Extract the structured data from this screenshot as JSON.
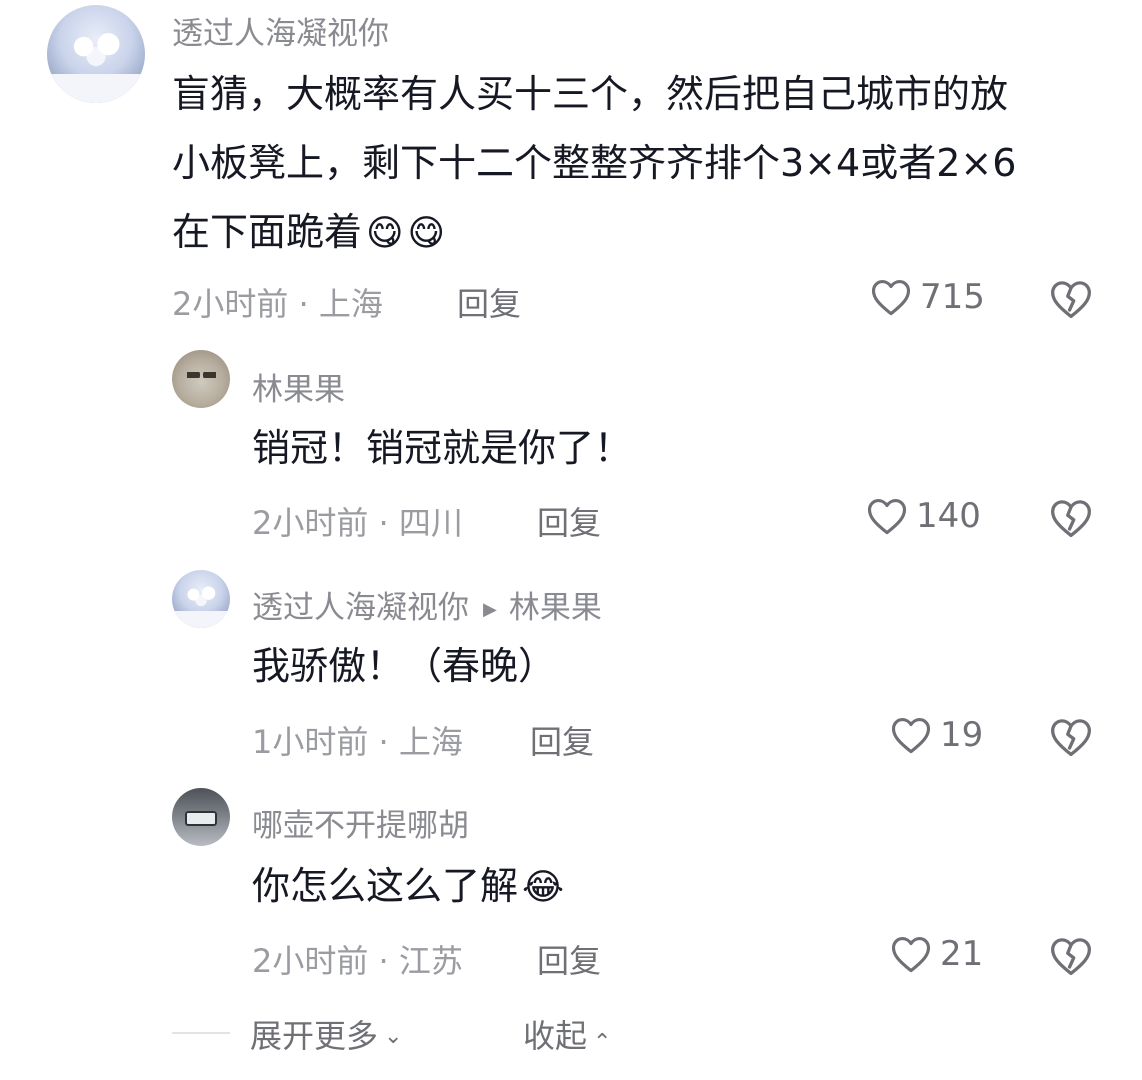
{
  "comments": [
    {
      "username": "透过人海凝视你",
      "text_lines": [
        "盲猜，大概率有人买十三个，然后把自己城市的放",
        "小板凳上，剩下十二个整整齐齐排个3×4或者2×6",
        "在下面跪着"
      ],
      "emojis": [
        "😋",
        "😋"
      ],
      "time_location": "2小时前 · 上海",
      "reply_label": "回复",
      "likes": "715"
    }
  ],
  "replies": [
    {
      "username": "林果果",
      "text": "销冠！销冠就是你了！",
      "time_location": "2小时前 · 四川",
      "reply_label": "回复",
      "likes": "140"
    },
    {
      "username": "透过人海凝视你",
      "reply_to": "林果果",
      "text": "我骄傲！（春晚）",
      "time_location": "1小时前 · 上海",
      "reply_label": "回复",
      "likes": "19"
    },
    {
      "username": "哪壶不开提哪胡",
      "text": "你怎么这么了解",
      "emoji": "😂",
      "time_location": "2小时前 · 江苏",
      "reply_label": "回复",
      "likes": "21"
    }
  ],
  "footer": {
    "expand_label": "展开更多",
    "collapse_label": "收起"
  },
  "icons": {
    "like": "heart-outline-icon",
    "dislike": "broken-heart-icon",
    "reply_arrow": "triangle-right-icon",
    "expand": "chevron-down-icon",
    "collapse": "chevron-up-icon"
  }
}
